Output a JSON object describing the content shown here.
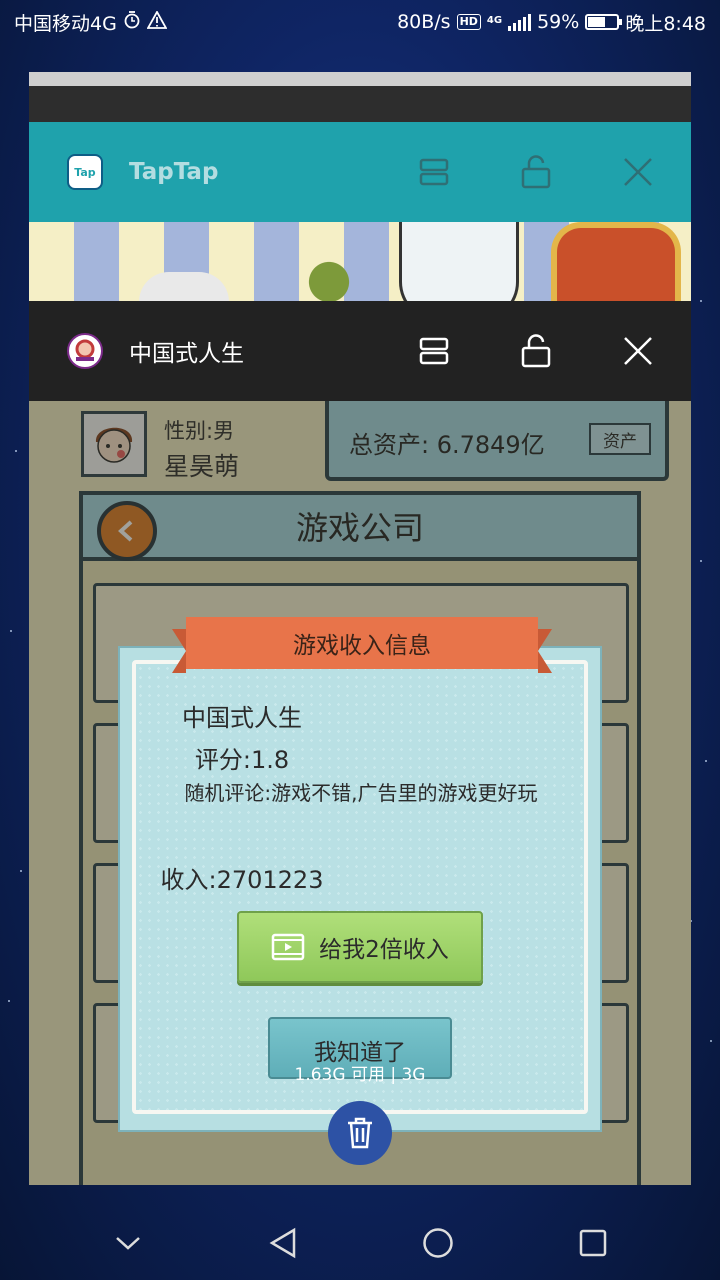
{
  "status_bar": {
    "carrier": "中国移动4G",
    "network_speed": "80B/s",
    "hd_badge": "HD",
    "network_type": "4G",
    "battery_percent": "59%",
    "battery_level": 0.59,
    "time": "晚上8:48"
  },
  "recent_apps": [
    {
      "title": "TapTap",
      "icon": "taptap-app-icon",
      "icon_text": "Tap",
      "header_color": "#1fa2ac"
    },
    {
      "title": "中国式人生",
      "icon": "zhongguoshi-rensheng-app-icon",
      "header_color": "#222222"
    }
  ],
  "card_controls": {
    "split_screen": "split-screen-icon",
    "lock": "unlock-icon",
    "close": "close-icon"
  },
  "game": {
    "gender": "性别:男",
    "player_name": "星昊萌",
    "total_assets": "总资产: 6.7849亿",
    "assets_button": "资产",
    "company_title": "游戏公司"
  },
  "dialog": {
    "title": "游戏收入信息",
    "game_name": "中国式人生",
    "score": "评分:1.8",
    "comment": "随机评论:游戏不错,广告里的游戏更好玩",
    "income": "收入:2701223",
    "double_button": "给我2倍收入",
    "ok_button": "我知道了"
  },
  "memory_info": "1.63G 可用 | 3G",
  "navigation": {
    "hide": "chevron-down-icon",
    "back": "back-triangle-icon",
    "home": "home-circle-icon",
    "recents": "recents-square-icon"
  },
  "colors": {
    "taptap": "#1fa2ac",
    "ribbon": "#e8744a",
    "dialog_bg": "#b9e0e4",
    "green_button": "#9fd46a",
    "trash_button": "#2d52a5"
  }
}
